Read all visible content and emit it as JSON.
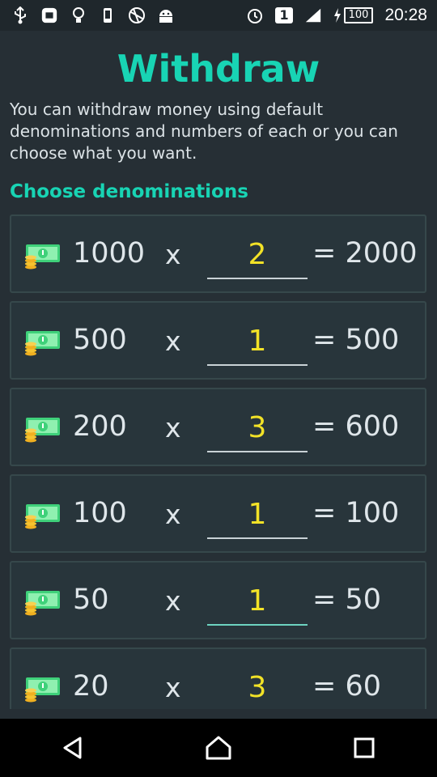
{
  "status_bar": {
    "left_icons": [
      "usb-icon",
      "sim-icon",
      "bulb-icon",
      "vibrate-icon",
      "ball-icon",
      "android-icon"
    ],
    "notification_count": "1",
    "battery_level": "100",
    "time": "20:28"
  },
  "header": {
    "title": "Withdraw",
    "description": "You can withdraw money using default denominations and numbers of each or you can choose what you want."
  },
  "section_title": "Choose denominations",
  "rows": [
    {
      "denomination": "1000",
      "times": "x",
      "quantity": "2",
      "total": "= 2000"
    },
    {
      "denomination": "500",
      "times": "x",
      "quantity": "1",
      "total": "= 500"
    },
    {
      "denomination": "200",
      "times": "x",
      "quantity": "3",
      "total": "= 600"
    },
    {
      "denomination": "100",
      "times": "x",
      "quantity": "1",
      "total": "= 100"
    },
    {
      "denomination": "50",
      "times": "x",
      "quantity": "1",
      "total": "= 50"
    },
    {
      "denomination": "20",
      "times": "x",
      "quantity": "3",
      "total": "= 60"
    }
  ],
  "colors": {
    "background": "#262f35",
    "accent": "#18d4b4",
    "quantity": "#f2e227"
  },
  "navigation": {
    "icons": [
      "back-icon",
      "home-icon",
      "recents-icon"
    ]
  }
}
